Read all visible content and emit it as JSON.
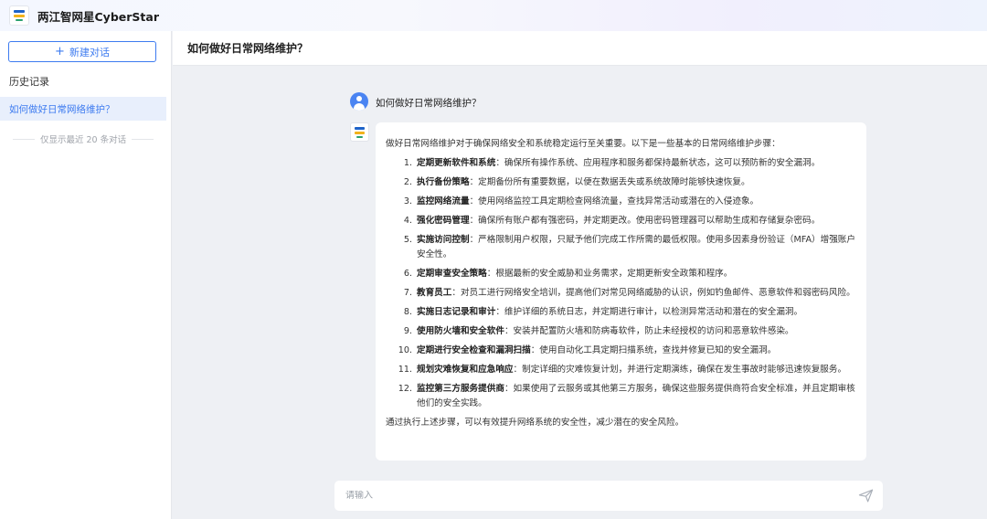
{
  "app": {
    "title": "两江智网星CyberStar",
    "logo_icon": "cyberstar-logo-icon"
  },
  "sidebar": {
    "new_chat_label": "新建对话",
    "history_label": "历史记录",
    "history_items": [
      {
        "label": "如何做好日常网络维护？",
        "active": true
      }
    ],
    "history_note": "仅显示最近 20 条对话"
  },
  "chat": {
    "title": "如何做好日常网络维护？",
    "user_message": "如何做好日常网络维护？",
    "bot_message": {
      "intro": "做好日常网络维护对于确保网络安全和系统稳定运行至关重要。以下是一些基本的日常网络维护步骤：",
      "steps": [
        {
          "num": "1.",
          "title": "定期更新软件和系统",
          "text": "：确保所有操作系统、应用程序和服务都保持最新状态，这可以预防新的安全漏洞。"
        },
        {
          "num": "2.",
          "title": "执行备份策略",
          "text": "：定期备份所有重要数据，以便在数据丢失或系统故障时能够快速恢复。"
        },
        {
          "num": "3.",
          "title": "监控网络流量",
          "text": "：使用网络监控工具定期检查网络流量，查找异常活动或潜在的入侵迹象。"
        },
        {
          "num": "4.",
          "title": "强化密码管理",
          "text": "：确保所有账户都有强密码，并定期更改。使用密码管理器可以帮助生成和存储复杂密码。"
        },
        {
          "num": "5.",
          "title": "实施访问控制",
          "text": "：严格限制用户权限，只赋予他们完成工作所需的最低权限。使用多因素身份验证（MFA）增强账户安全性。"
        },
        {
          "num": "6.",
          "title": "定期审查安全策略",
          "text": "：根据最新的安全威胁和业务需求，定期更新安全政策和程序。"
        },
        {
          "num": "7.",
          "title": "教育员工",
          "text": "：对员工进行网络安全培训，提高他们对常见网络威胁的认识，例如钓鱼邮件、恶意软件和弱密码风险。"
        },
        {
          "num": "8.",
          "title": "实施日志记录和审计",
          "text": "：维护详细的系统日志，并定期进行审计，以检测异常活动和潜在的安全漏洞。"
        },
        {
          "num": "9.",
          "title": "使用防火墙和安全软件",
          "text": "：安装并配置防火墙和防病毒软件，防止未经授权的访问和恶意软件感染。"
        },
        {
          "num": "10.",
          "title": "定期进行安全检查和漏洞扫描",
          "text": "：使用自动化工具定期扫描系统，查找并修复已知的安全漏洞。"
        },
        {
          "num": "11.",
          "title": "规划灾难恢复和应急响应",
          "text": "：制定详细的灾难恢复计划，并进行定期演练，确保在发生事故时能够迅速恢复服务。"
        },
        {
          "num": "12.",
          "title": "监控第三方服务提供商",
          "text": "：如果使用了云服务或其他第三方服务，确保这些服务提供商符合安全标准，并且定期审核他们的安全实践。"
        }
      ],
      "outro": "通过执行上述步骤，可以有效提升网络系统的安全性，减少潜在的安全风险。"
    },
    "input": {
      "placeholder": "请输入",
      "value": ""
    },
    "send_icon": "send-icon"
  },
  "colors": {
    "accent": "#3d7bf0",
    "background": "#eef0f4",
    "active_item_bg": "#e8effc"
  }
}
